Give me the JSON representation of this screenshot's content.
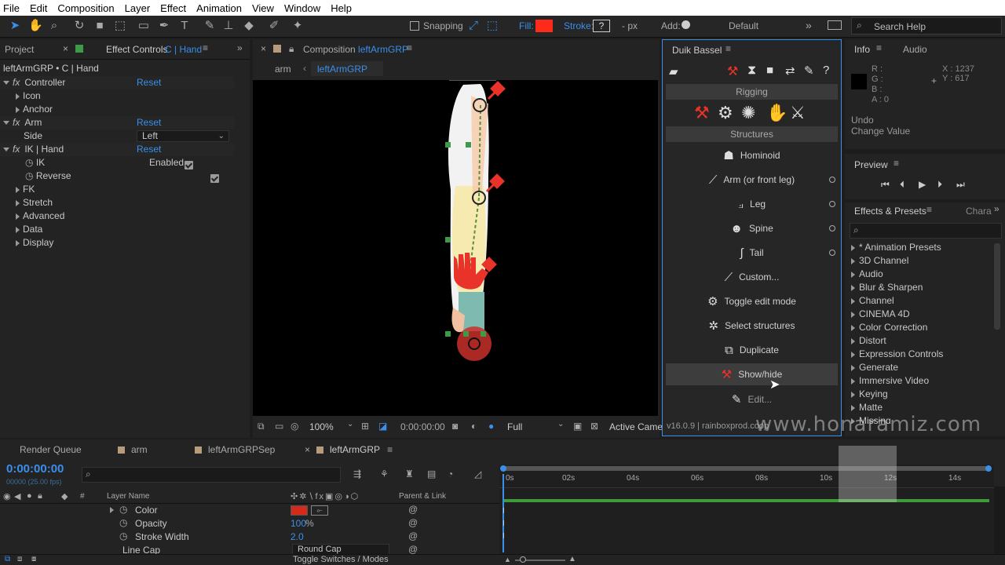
{
  "menu": [
    "File",
    "Edit",
    "Composition",
    "Layer",
    "Effect",
    "Animation",
    "View",
    "Window",
    "Help"
  ],
  "toolbar": {
    "snapping": "Snapping",
    "fill": "Fill:",
    "stroke": "Stroke:",
    "stroke_val": "?",
    "px": "- px",
    "add": "Add:",
    "workspace": "Default",
    "search": "Search Help",
    "fill_color": "#ff2b1a"
  },
  "left": {
    "tab_project": "Project",
    "tab_effect": "Effect Controls",
    "tab_effect_layer": "C | Hand",
    "title": "leftArmGRP • C | Hand",
    "rows": {
      "controller": "Controller",
      "reset": "Reset",
      "icon": "Icon",
      "anchor": "Anchor",
      "arm": "Arm",
      "side": "Side",
      "side_val": "Left",
      "ikhand": "IK | Hand",
      "ik": "IK",
      "enabled": "Enabled",
      "reverse": "Reverse",
      "fk": "FK",
      "stretch": "Stretch",
      "advanced": "Advanced",
      "data": "Data",
      "display": "Display"
    }
  },
  "comp": {
    "tab": "Composition",
    "tab_name": "leftArmGRP",
    "crumb1": "arm",
    "crumb2": "leftArmGRP",
    "zoom": "100%",
    "time": "0:00:00:00",
    "quality": "Full",
    "camera": "Active Came"
  },
  "duik": {
    "title": "Duik Bassel",
    "rigging": "Rigging",
    "structures": "Structures",
    "buttons": [
      "Hominoid",
      "Arm (or front leg)",
      "Leg",
      "Spine",
      "Tail",
      "Custom...",
      "Toggle edit mode",
      "Select structures",
      "Duplicate",
      "Show/hide",
      "Edit..."
    ],
    "version": "v16.0.9 | rainboxprod.coop"
  },
  "info": {
    "tab": "Info",
    "tab2": "Audio",
    "r": "R :",
    "g": "G :",
    "b": "B :",
    "a": "A : 0",
    "x": "X : 1237",
    "y": "Y : 617",
    "undo": "Undo",
    "undo_action": "Change Value"
  },
  "preview": {
    "title": "Preview"
  },
  "effects": {
    "tab": "Effects & Presets",
    "tab2": "Chara",
    "items": [
      "* Animation Presets",
      "3D Channel",
      "Audio",
      "Blur & Sharpen",
      "Channel",
      "CINEMA 4D",
      "Color Correction",
      "Distort",
      "Expression Controls",
      "Generate",
      "Immersive Video",
      "Keying",
      "Matte",
      "Missing"
    ]
  },
  "timeline": {
    "tabs": [
      "Render Queue",
      "arm",
      "leftArmGRPSep",
      "leftArmGRP"
    ],
    "timecode": "0:00:00:00",
    "fps": "00000 (25.00 fps)",
    "col_layer": "Layer Name",
    "col_parent": "Parent & Link",
    "col_num": "#",
    "rows": [
      {
        "name": "Color",
        "val": ""
      },
      {
        "name": "Opacity",
        "val": "100",
        "unit": "%"
      },
      {
        "name": "Stroke Width",
        "val": "2.0"
      },
      {
        "name": "Line Cap",
        "val": "Round Cap"
      }
    ],
    "ruler": [
      "0s",
      "02s",
      "04s",
      "06s",
      "08s",
      "10s",
      "12s",
      "14s"
    ],
    "toggle": "Toggle Switches / Modes"
  },
  "watermark": "www.honaramiz.com"
}
